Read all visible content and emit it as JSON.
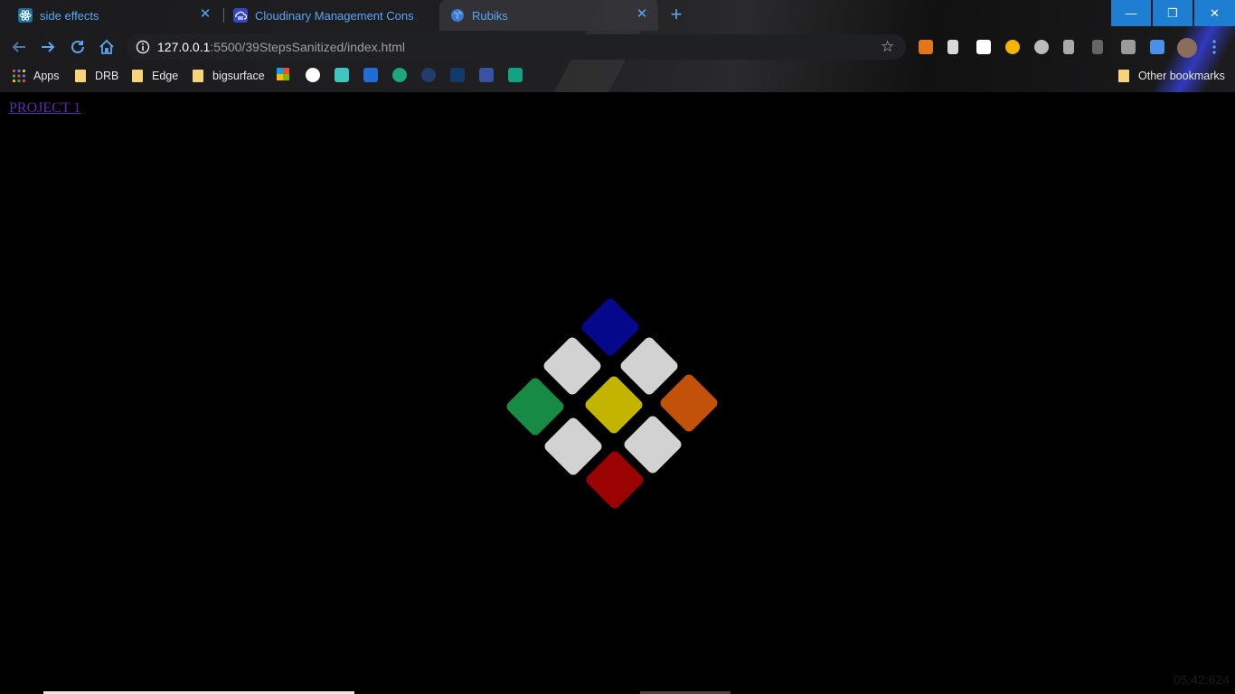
{
  "browser": {
    "tabs": [
      {
        "title": "side effects",
        "favicon": "react-icon",
        "active": false
      },
      {
        "title": "Cloudinary Management Console",
        "favicon": "cloudinary-icon",
        "active": false
      },
      {
        "title": "Rubiks",
        "favicon": "globe-icon",
        "active": true
      }
    ],
    "new_tab_label": "+",
    "url_host": "127.0.0.1",
    "url_rest": ":5500/39StepsSanitized/index.html",
    "window_controls": {
      "minimize": "—",
      "restore": "❐",
      "close": "✕"
    },
    "bookmarks": [
      {
        "label": "Apps",
        "icon": "apps-grid-icon"
      },
      {
        "label": "DRB",
        "icon": "folder-icon"
      },
      {
        "label": "Edge",
        "icon": "folder-icon"
      },
      {
        "label": "bigsurface",
        "icon": "folder-icon"
      }
    ],
    "other_bookmarks": "Other bookmarks",
    "accent": "#5aa6f5"
  },
  "page": {
    "link_text": "PROJECT 1",
    "clock": "05:42:624",
    "cube_colors": {
      "blue": "#05088a",
      "white": "#d2d2d2",
      "green": "#178a45",
      "yellow": "#c3b400",
      "orange": "#c2520a",
      "red": "#9b0202"
    }
  }
}
